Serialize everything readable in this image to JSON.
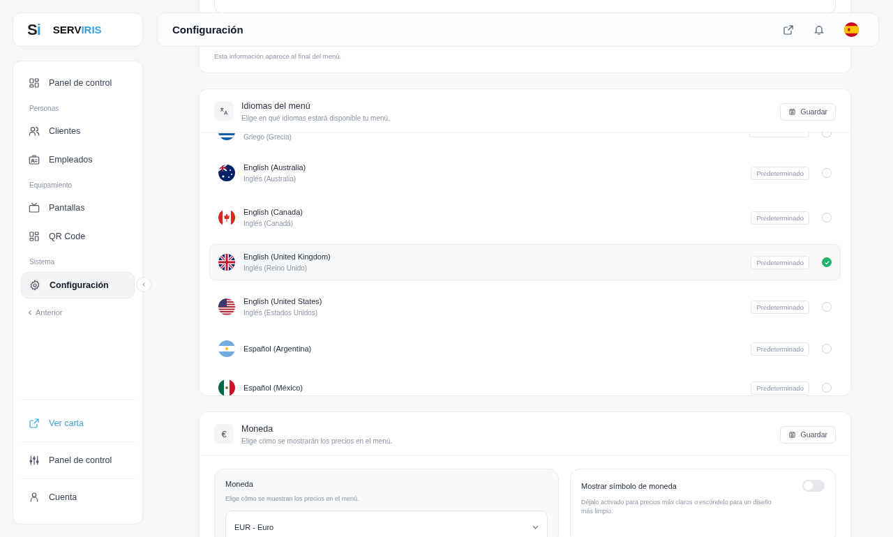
{
  "brand": {
    "mark_left": "S",
    "mark_right": "i",
    "name_left": "SERV",
    "name_right": "IRIS"
  },
  "sidebar": {
    "items": [
      {
        "kind": "item",
        "label": "Panel de control",
        "selected": false
      },
      {
        "kind": "section",
        "label": "Personas"
      },
      {
        "kind": "item",
        "label": "Clientes",
        "selected": false
      },
      {
        "kind": "item",
        "label": "Empleados",
        "selected": false
      },
      {
        "kind": "section",
        "label": "Equipamiento"
      },
      {
        "kind": "item",
        "label": "Pantallas",
        "selected": false
      },
      {
        "kind": "item",
        "label": "QR Code",
        "selected": false
      },
      {
        "kind": "section",
        "label": "Sistema"
      },
      {
        "kind": "item",
        "label": "Configuración",
        "selected": true
      },
      {
        "kind": "back",
        "label": "Anterior"
      }
    ],
    "footer": [
      {
        "label": "Ver carta",
        "link": true
      },
      {
        "label": "Panel de control",
        "link": false
      },
      {
        "label": "Cuenta",
        "link": false
      }
    ]
  },
  "header": {
    "title": "Configuración"
  },
  "info_card": {
    "note": "Esta información aparece al final del menú."
  },
  "languages": {
    "title": "Idiomas del menú",
    "subtitle": "Elige en qué idiomas estará disponible tu menú.",
    "save": "Guardar",
    "rows": [
      {
        "subtitle": "Griego (Grecia)",
        "selected": false
      },
      {
        "name": "English (Australia)",
        "subtitle": "Inglés (Australia)",
        "badge": "Predeterminado",
        "selected": false
      },
      {
        "name": "English (Canada)",
        "subtitle": "Inglés (Canadá)",
        "badge": "Predeterminado",
        "selected": false
      },
      {
        "name": "English (United Kingdom)",
        "subtitle": "Inglés (Reino Unido)",
        "badge": "Predeterminado",
        "selected": true
      },
      {
        "name": "English (United States)",
        "subtitle": "Inglés (Estados Unidos)",
        "badge": "Predeterminado",
        "selected": false
      },
      {
        "name": "Español (Argentina)",
        "badge": "Predeterminado",
        "selected": false
      },
      {
        "name": "Español (México)",
        "badge": "Predeterminado",
        "selected": false
      }
    ]
  },
  "currency": {
    "icon": "€",
    "title": "Moneda",
    "subtitle": "Elige cómo se mostrarán los precios en el menú.",
    "save": "Guardar",
    "select": {
      "label": "Moneda",
      "hint": "Elige cómo se muestran los precios en el menú.",
      "value": "EUR - Euro"
    },
    "symbol": {
      "label": "Mostrar símbolo de moneda",
      "hint": "Déjalo activado para precios más claros o escóndelo para un diseño más limpio.",
      "on": false
    }
  }
}
